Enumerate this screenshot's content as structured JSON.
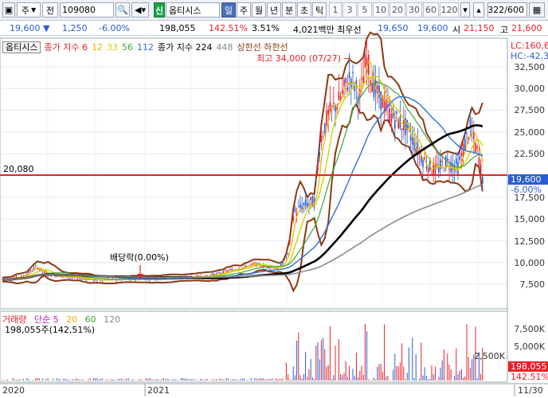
{
  "toolbar": {
    "market_label": "주",
    "type_label": "전",
    "code": "109080",
    "logo_label": "신",
    "stock_name": "옵티시스",
    "day_label": "일",
    "week_label": "주",
    "month_label": "월",
    "year_label": "년",
    "minute_label": "분",
    "second_label": "초",
    "tick_label": "틱",
    "periods": [
      "1",
      "3",
      "5",
      "10",
      "20",
      "30",
      "60",
      "120"
    ],
    "count": "322/600"
  },
  "quote": {
    "price": "19,600 ▼",
    "change": "1,250",
    "change_pct": "-6.00%",
    "volume": "198,055",
    "volume_ratio": "142.51%",
    "turnover_pct": "3.51%",
    "value_text": "4,021백만 최우선",
    "best_ask": "19,650",
    "best_bid": "19,600",
    "open_label": "시",
    "open": "21,150",
    "high_label": "고",
    "high": "21,600"
  },
  "legend": {
    "name": "옵티시스",
    "ma_label": "종가 지수 6",
    "ma12": "12",
    "ma33": "33",
    "ma56": "56",
    "ma112": "112",
    "ma224_label": "종가 지수 224",
    "ma448": "448",
    "band_label": "상한선 하한선"
  },
  "annotations": {
    "high_note": "최고 34,000 (07/27) →",
    "dividend": "배당락(0.00%)",
    "ref_price": "20,080"
  },
  "right_tags": {
    "lc": "LC:160,6",
    "hc": "HC:-42,3",
    "price": "19,600",
    "pct": "-6.00%",
    "vol": "198,055",
    "vol_pct": "142.51%"
  },
  "yaxis": [
    "32,500",
    "30,000",
    "27,500",
    "25,000",
    "22,500",
    "17,500",
    "15,000",
    "12,500",
    "10,000",
    "7,500"
  ],
  "volume_panel": {
    "legend_name": "거래량",
    "ma_label": "단순 5",
    "ma20": "20",
    "ma60": "60",
    "ma120": "120",
    "stat": "198,055주(142,51%)",
    "yaxis": [
      "7,500K",
      "5,000K",
      "2,500K"
    ]
  },
  "xaxis": [
    "2020",
    "2021",
    "11/30"
  ],
  "colors": {
    "up": "#e8202a",
    "down": "#2a5bd7",
    "ma6": "#f0b000",
    "ma33": "#d6d000",
    "ma56": "#38a83c",
    "ma112": "#2f6fe0",
    "ma224": "#000000",
    "ma448": "#8c8c8c",
    "band": "#8b3a12"
  }
}
